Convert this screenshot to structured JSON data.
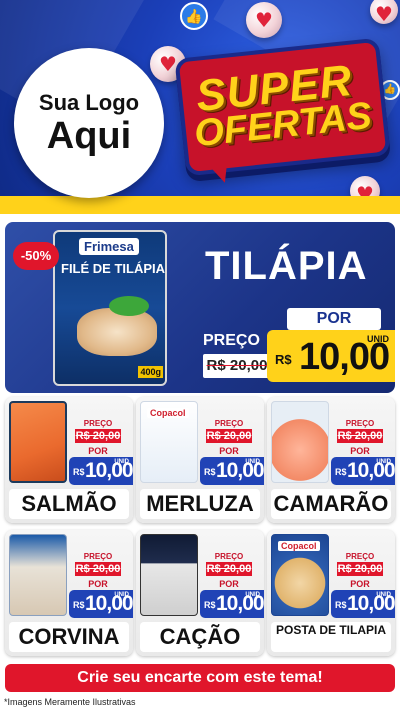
{
  "brand": {
    "logo_line1": "Sua Logo",
    "logo_line2": "Aqui"
  },
  "banner": {
    "title_line1": "SUPER",
    "title_line2": "OFERTAS"
  },
  "featured": {
    "discount_badge": "-50%",
    "product_name": "TILÁPIA",
    "package_brand": "Frimesa",
    "package_title": "FILÉ DE TILÁPIA",
    "package_weight": "400g",
    "price_label": "PREÇO",
    "old_price": "R$ 20,00",
    "por_label": "POR",
    "currency": "R$",
    "new_price": "10,00",
    "unit": "UNID"
  },
  "products": [
    {
      "name": "SALMÃO",
      "price_label": "PREÇO",
      "old_price": "R$ 20,00",
      "por_label": "POR",
      "currency": "R$",
      "new_price": "10,00",
      "unit": "UNID"
    },
    {
      "name": "MERLUZA",
      "brand": "Copacol",
      "price_label": "PREÇO",
      "old_price": "R$ 20,00",
      "por_label": "POR",
      "currency": "R$",
      "new_price": "10,00",
      "unit": "UNID"
    },
    {
      "name": "CAMARÃO",
      "price_label": "PREÇO",
      "old_price": "R$ 20,00",
      "por_label": "POR",
      "currency": "R$",
      "new_price": "10,00",
      "unit": "UNID"
    },
    {
      "name": "CORVINA",
      "price_label": "PREÇO",
      "old_price": "R$ 20,00",
      "por_label": "POR",
      "currency": "R$",
      "new_price": "10,00",
      "unit": "UNID"
    },
    {
      "name": "CAÇÃO",
      "price_label": "PREÇO",
      "old_price": "R$ 20,00",
      "por_label": "POR",
      "currency": "R$",
      "new_price": "10,00",
      "unit": "UNID"
    },
    {
      "name": "POSTA DE TILAPIA",
      "brand": "Copacol",
      "price_label": "PREÇO",
      "old_price": "R$ 20,00",
      "por_label": "POR",
      "currency": "R$",
      "new_price": "10,00",
      "unit": "UNID"
    }
  ],
  "cta": {
    "label": "Crie seu encarte com este tema!"
  },
  "footer": {
    "disclaimer": "*Imagens Meramente Ilustrativas"
  },
  "colors": {
    "brand_red": "#e0162b",
    "brand_blue": "#2043b6",
    "brand_yellow": "#ffd21a"
  }
}
